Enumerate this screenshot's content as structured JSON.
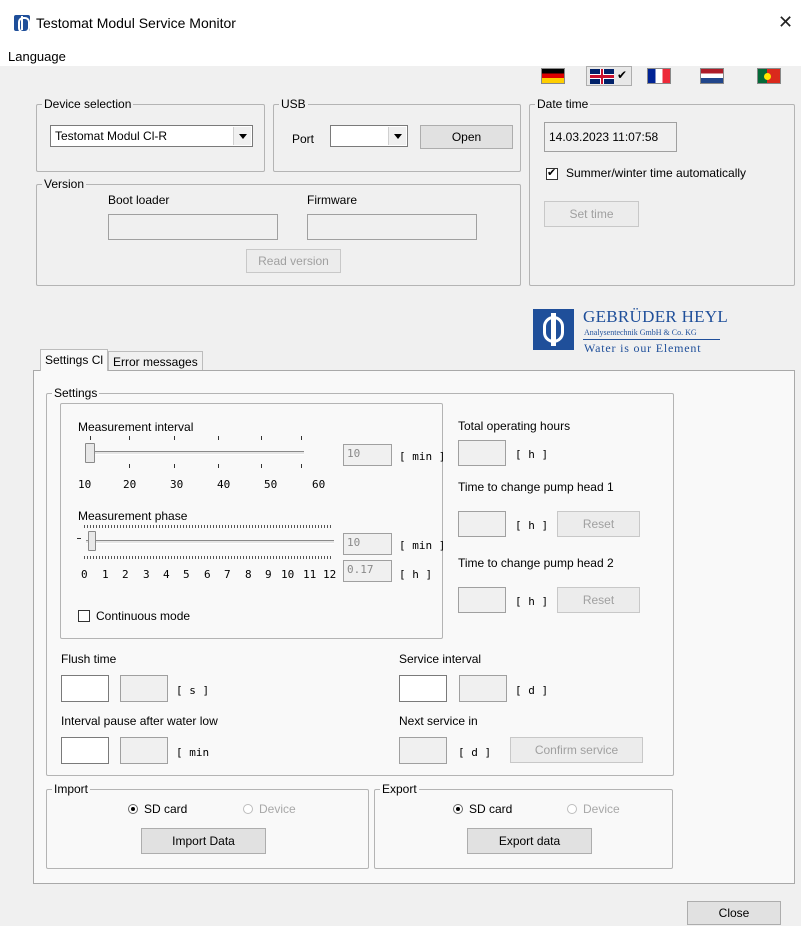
{
  "window": {
    "title": "Testomat Modul Service Monitor",
    "close_glyph": "✕"
  },
  "menu": {
    "language": "Language"
  },
  "device_selection": {
    "title": "Device selection",
    "value": "Testomat Modul Cl-R"
  },
  "usb": {
    "title": "USB",
    "port_label": "Port",
    "port_value": "",
    "open_label": "Open"
  },
  "date_time": {
    "title": "Date time",
    "value": "14.03.2023  11:07:58",
    "summer_winter_label": "Summer/winter time automatically",
    "summer_winter_checked": true,
    "set_time_label": "Set time"
  },
  "version": {
    "title": "Version",
    "bootloader_label": "Boot loader",
    "firmware_label": "Firmware",
    "bootloader_value": "",
    "firmware_value": "",
    "read_label": "Read version"
  },
  "logo": {
    "name": "GEBRÜDER HEYL",
    "subtitle": "Analysentechnik GmbH & Co. KG",
    "slogan": "Water is our Element"
  },
  "tabs": [
    {
      "label": "Settings Cl"
    },
    {
      "label": "Error messages"
    }
  ],
  "settings": {
    "title": "Settings",
    "measurement_interval": {
      "label": "Measurement interval",
      "value": "10",
      "unit": "[ min ]",
      "tick_labels": [
        "10",
        "20",
        "30",
        "40",
        "50",
        "60"
      ]
    },
    "measurement_phase": {
      "label": "Measurement phase",
      "value": "10",
      "unit": "[ min ]",
      "hours_value": "0.17",
      "hours_unit": "[ h ]",
      "tick_labels": [
        "0",
        "1",
        "2",
        "3",
        "4",
        "5",
        "6",
        "7",
        "8",
        "9",
        "10",
        "11",
        "12"
      ]
    },
    "continuous_mode": "Continuous mode",
    "total_operating_hours": {
      "label": "Total operating hours",
      "unit": "[ h ]"
    },
    "pump_head_1": {
      "label": "Time to change pump head 1",
      "unit": "[ h ]",
      "reset": "Reset"
    },
    "pump_head_2": {
      "label": "Time to change pump head 2",
      "unit": "[ h ]",
      "reset": "Reset"
    },
    "flush_time": {
      "label": "Flush time",
      "unit": "[ s ]"
    },
    "interval_pause": {
      "label": "Interval pause after water low",
      "unit": "[ min"
    },
    "service_interval": {
      "label": "Service interval",
      "unit": "[ d ]"
    },
    "next_service": {
      "label": "Next service in",
      "unit": "[ d ]",
      "confirm": "Confirm service"
    }
  },
  "import": {
    "title": "Import",
    "sd_card": "SD card",
    "device": "Device",
    "button": "Import Data"
  },
  "export": {
    "title": "Export",
    "sd_card": "SD card",
    "device": "Device",
    "button": "Export data"
  },
  "footer": {
    "close": "Close"
  },
  "colors": {
    "brand": "#1f4f9a",
    "background": "#f0f0f0"
  }
}
